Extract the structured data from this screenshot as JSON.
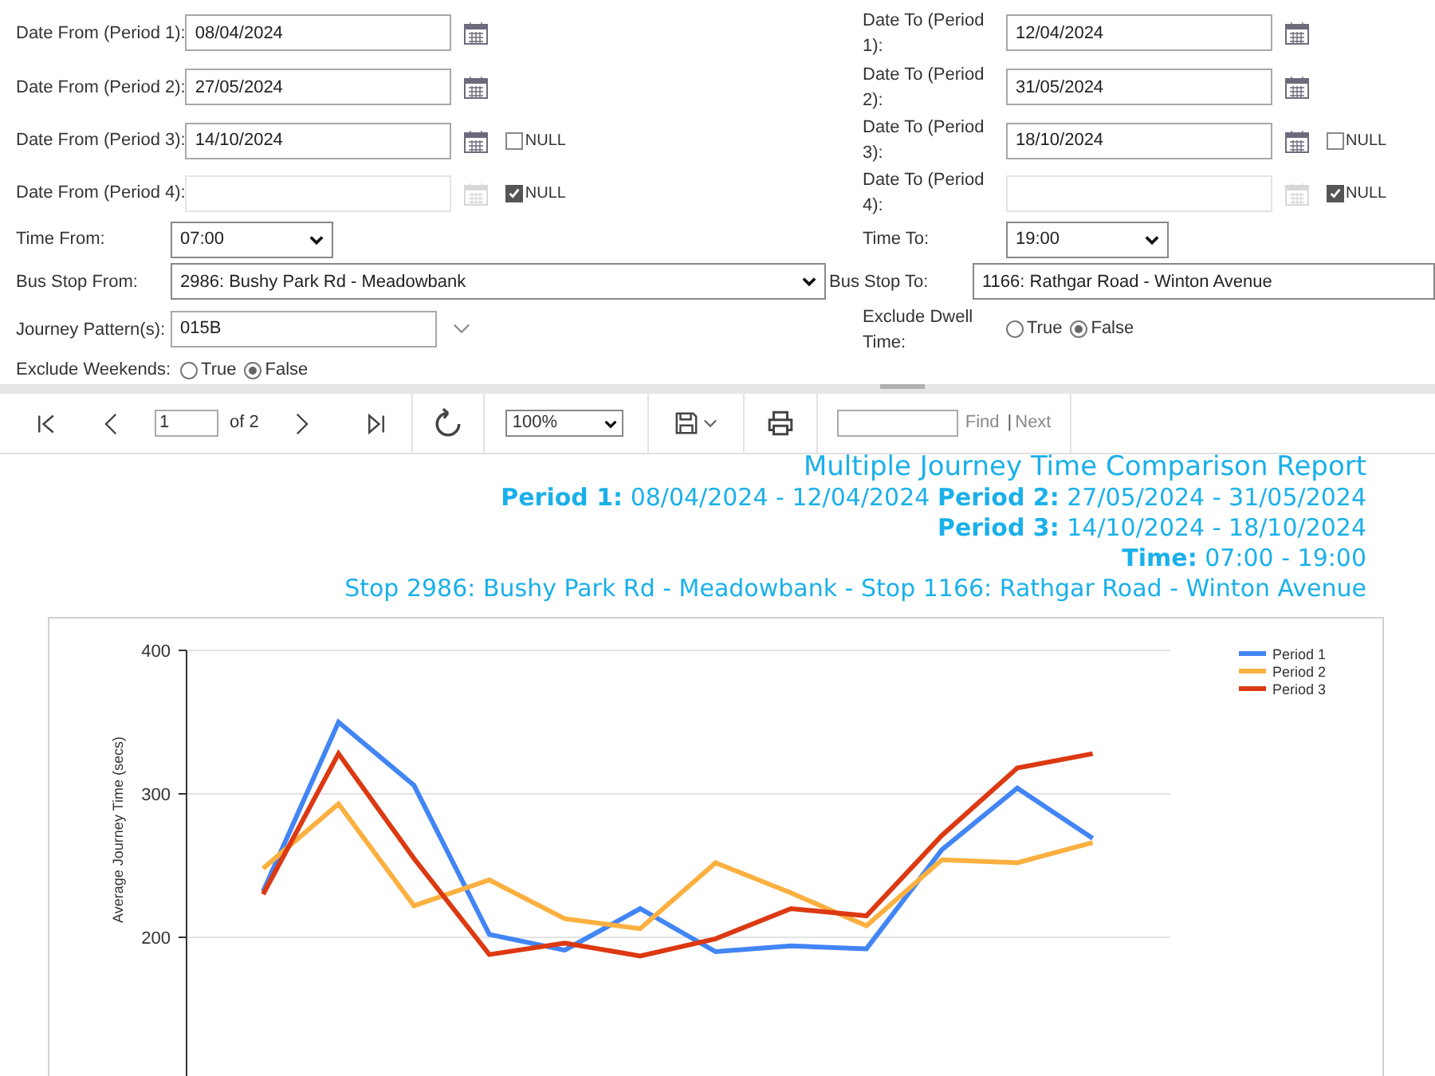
{
  "parameters": {
    "rows": [
      {
        "left": {
          "kind": "date",
          "label": "Date From (Period 1):",
          "value": "08/04/2024",
          "disabled": false
        },
        "right": {
          "kind": "date",
          "label": "Date To (Period 1):",
          "value": "12/04/2024",
          "disabled": false
        }
      },
      {
        "left": {
          "kind": "date",
          "label": "Date From (Period 2):",
          "value": "27/05/2024",
          "disabled": false
        },
        "right": {
          "kind": "date",
          "label": "Date To (Period 2):",
          "value": "31/05/2024",
          "disabled": false
        }
      },
      {
        "left": {
          "kind": "date",
          "label": "Date From (Period 3):",
          "value": "14/10/2024",
          "disabled": false,
          "null_option": {
            "label": "NULL",
            "checked": false
          }
        },
        "right": {
          "kind": "date",
          "label": "Date To (Period 3):",
          "value": "18/10/2024",
          "disabled": false,
          "null_option": {
            "label": "NULL",
            "checked": false
          }
        }
      },
      {
        "left": {
          "kind": "date",
          "label": "Date From (Period 4):",
          "disabled": true,
          "null_option": {
            "label": "NULL",
            "checked": true
          }
        },
        "right": {
          "kind": "date",
          "label": "Date To (Period 4):",
          "disabled": true,
          "null_option": {
            "label": "NULL",
            "checked": true
          }
        }
      },
      {
        "left": {
          "kind": "select",
          "label": "Time From:",
          "value": "07:00"
        },
        "right": {
          "kind": "select",
          "label": "Time To:",
          "value": "19:00"
        }
      },
      {
        "left": {
          "kind": "wide",
          "label": "Bus Stop From:",
          "value": "2986: Bushy Park Rd - Meadowbank"
        },
        "right": {
          "kind": "wide",
          "label": "Bus Stop To:",
          "value": "1166: Rathgar Road - Winton Avenue"
        }
      },
      {
        "left": {
          "kind": "multi",
          "label": "Journey Pattern(s):",
          "value": "015B"
        },
        "right": {
          "kind": "radio",
          "label": "Exclude Dwell Time:",
          "options": [
            {
              "label": "True",
              "selected": false
            },
            {
              "label": "False",
              "selected": true
            }
          ]
        }
      },
      {
        "left": {
          "kind": "radio",
          "label": "Exclude Weekends:",
          "options": [
            {
              "label": "True",
              "selected": false
            },
            {
              "label": "False",
              "selected": true
            }
          ]
        }
      }
    ]
  },
  "toolbar": {
    "page": "1",
    "page_count": "of 2",
    "zoom": "100%",
    "find_link": "Find",
    "separator": "|",
    "next_link": "Next"
  },
  "report": {
    "title": "Multiple Journey Time Comparison Report",
    "lines": [
      "**Period 1:** 08/04/2024 - 12/04/2024 **Period 2:** 27/05/2024 - 31/05/2024",
      "**Period 3:** 14/10/2024 - 18/10/2024",
      "**Time:** 07:00 - 19:00"
    ],
    "stops": "Stop 2986: Bushy Park Rd - Meadowbank - Stop 1166: Rathgar Road - Winton Avenue",
    "chart_data": {
      "type": "line",
      "ylabel": "Average Journey Time (secs)",
      "legend": "right",
      "ylim": [
        100,
        400
      ],
      "yticks": [
        200,
        300,
        400
      ],
      "series": [
        {
          "name": "Period 1",
          "color": "#4285f4",
          "values": [
            232,
            350,
            306,
            202,
            191,
            220,
            190,
            194,
            192,
            261,
            304,
            269
          ]
        },
        {
          "name": "Period 2",
          "color": "#fbb040",
          "values": [
            248,
            293,
            222,
            240,
            213,
            206,
            252,
            231,
            208,
            254,
            252,
            266
          ]
        },
        {
          "name": "Period 3",
          "color": "#dc3912",
          "values": [
            230,
            328,
            255,
            188,
            196,
            187,
            199,
            220,
            215,
            271,
            318,
            328
          ]
        }
      ]
    }
  }
}
